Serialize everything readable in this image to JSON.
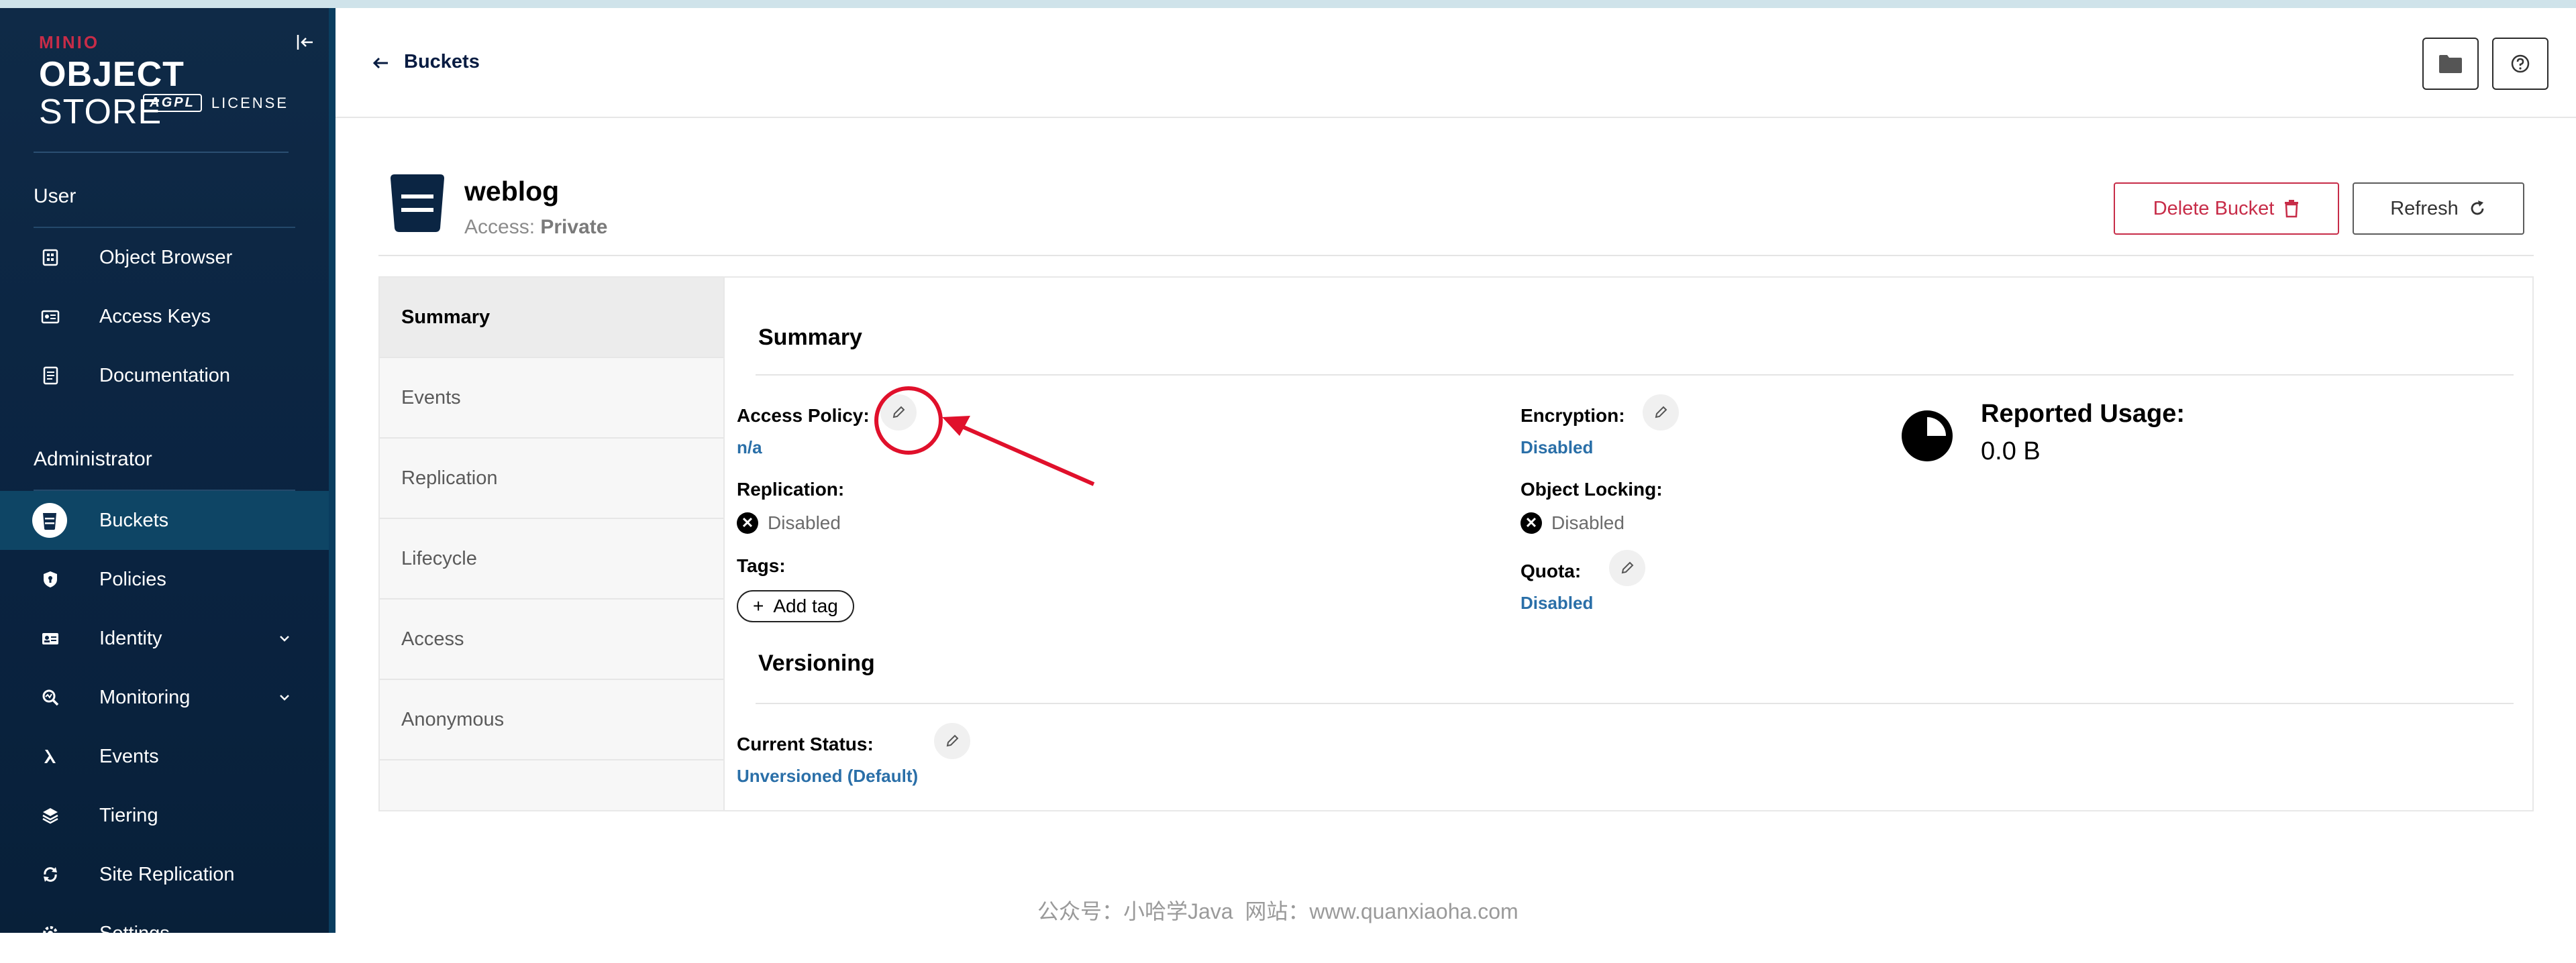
{
  "brand": {
    "minio": "MINIO",
    "product_bold": "OBJECT",
    "product_light": "STORE",
    "agpl": "AGPL",
    "license": "LICENSE"
  },
  "sidebar": {
    "user_section": "User",
    "user_items": [
      {
        "label": "Object Browser",
        "icon": "object-browser-icon"
      },
      {
        "label": "Access Keys",
        "icon": "access-keys-icon"
      },
      {
        "label": "Documentation",
        "icon": "documentation-icon"
      }
    ],
    "admin_section": "Administrator",
    "admin_items": [
      {
        "label": "Buckets",
        "icon": "bucket-icon",
        "active": true
      },
      {
        "label": "Policies",
        "icon": "shield-icon"
      },
      {
        "label": "Identity",
        "icon": "identity-icon",
        "expandable": true
      },
      {
        "label": "Monitoring",
        "icon": "monitoring-icon",
        "expandable": true
      },
      {
        "label": "Events",
        "icon": "lambda-icon"
      },
      {
        "label": "Tiering",
        "icon": "tiering-icon"
      },
      {
        "label": "Site Replication",
        "icon": "site-replication-icon"
      },
      {
        "label": "Settings",
        "icon": "settings-icon"
      }
    ]
  },
  "header": {
    "back_label": "Buckets"
  },
  "bucket": {
    "name": "weblog",
    "access_label": "Access:",
    "access_value": "Private",
    "delete_label": "Delete Bucket",
    "refresh_label": "Refresh"
  },
  "tabs": [
    "Summary",
    "Events",
    "Replication",
    "Lifecycle",
    "Access",
    "Anonymous"
  ],
  "summary": {
    "title": "Summary",
    "access_policy_label": "Access Policy:",
    "access_policy_value": "n/a",
    "replication_label": "Replication:",
    "replication_value": "Disabled",
    "tags_label": "Tags:",
    "add_tag_label": "Add tag",
    "encryption_label": "Encryption:",
    "encryption_value": "Disabled",
    "object_locking_label": "Object Locking:",
    "object_locking_value": "Disabled",
    "quota_label": "Quota:",
    "quota_value": "Disabled",
    "reported_usage_label": "Reported Usage:",
    "reported_usage_value": "0.0 B"
  },
  "versioning": {
    "title": "Versioning",
    "current_status_label": "Current Status:",
    "current_status_value": "Unversioned (Default)"
  },
  "watermark": "公众号：小哈学Java  网站：www.quanxiaoha.com",
  "colors": {
    "sidebar_bg": "#0b2543",
    "active_nav": "#0e4565",
    "link": "#2a6fa8",
    "delete": "#c72c48",
    "annotation": "#e0102b"
  }
}
